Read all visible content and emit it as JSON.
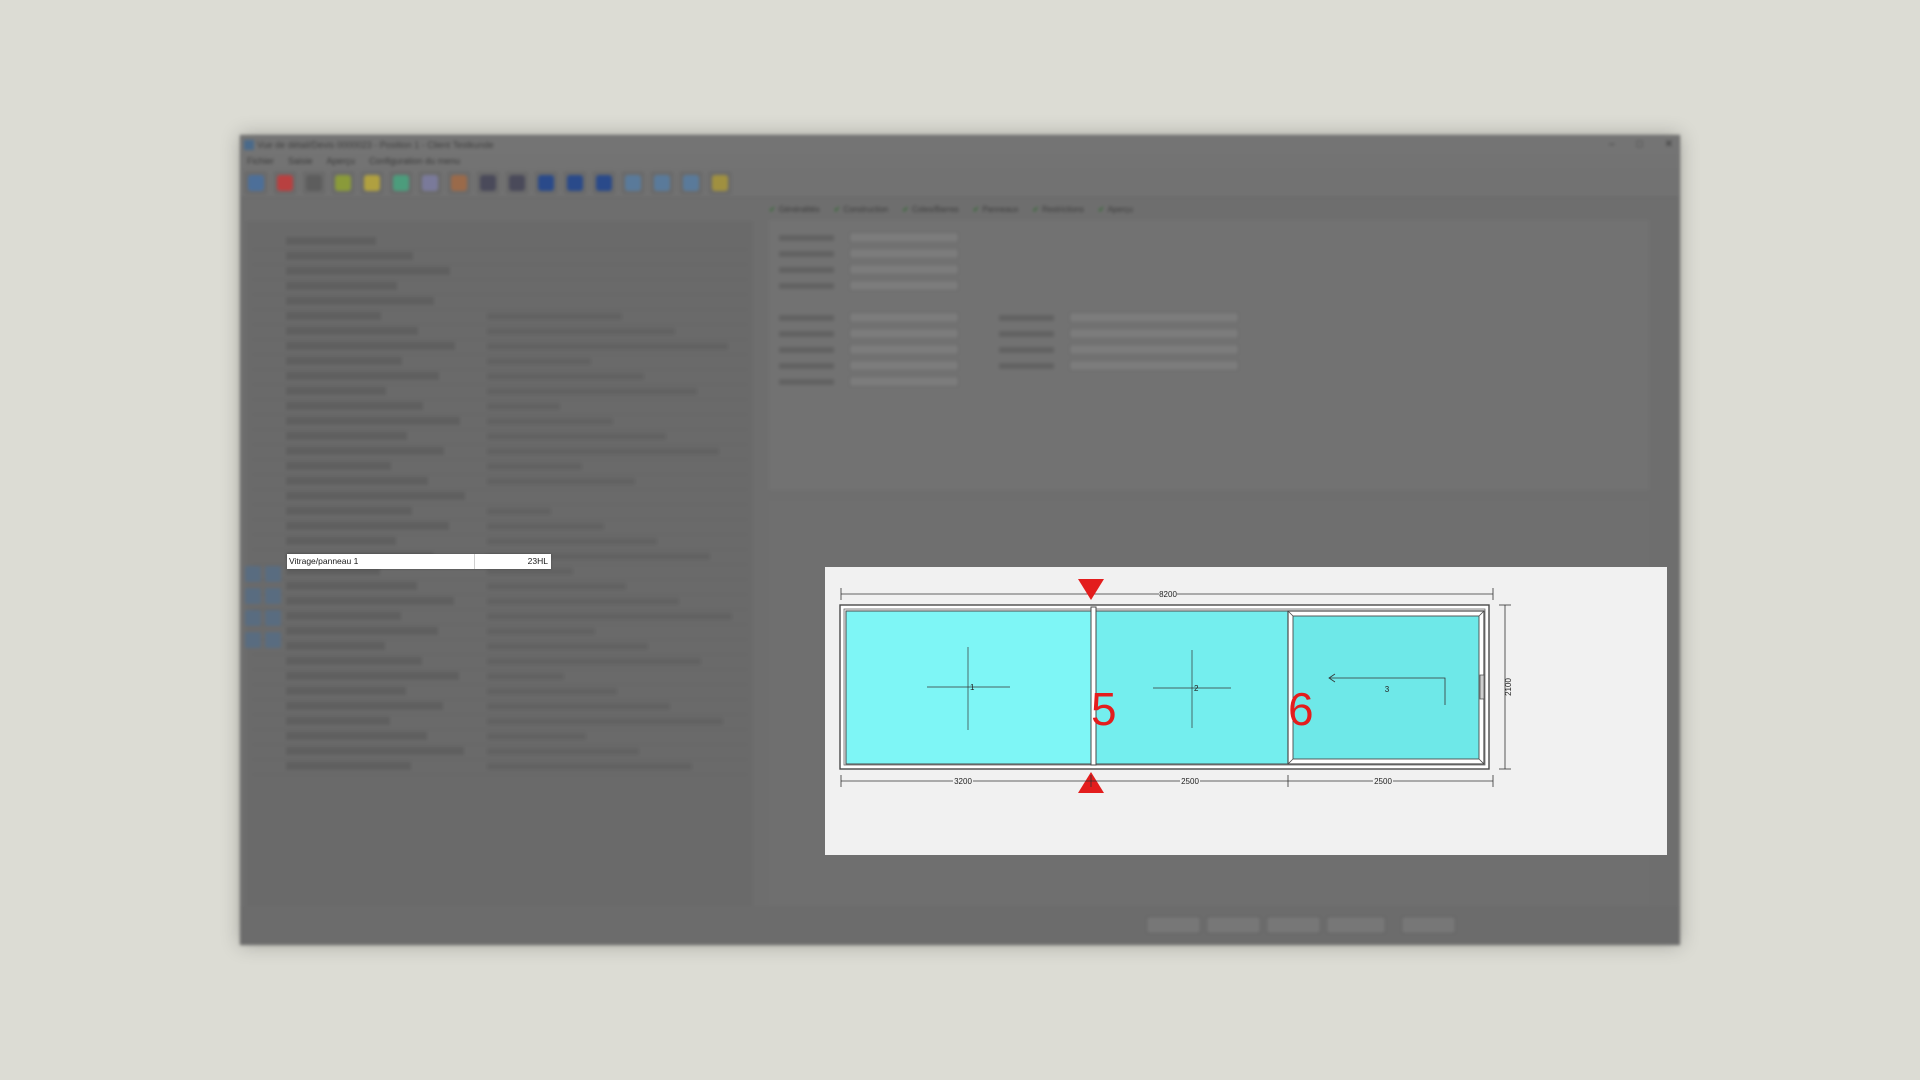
{
  "window": {
    "title": "Vue de détail/Devis 0000023 - Position 1 - Client Testkunde",
    "controls": [
      "–",
      "□",
      "✕"
    ]
  },
  "menu": [
    "Fichier",
    "Saisie",
    "Aperçu",
    "Configuration du menu"
  ],
  "toolbar": {
    "icon_colors": [
      "#4d6f99",
      "#b84040",
      "#5d5d5d",
      "#8a9a3a",
      "#b0a040",
      "#4c9c7c",
      "#7a7a9a",
      "#9a6a4a",
      "#4a4a5a",
      "#4a4a5a",
      "#2a4a8a",
      "#2a4a8a",
      "#2a4a8a",
      "#5a7a9a",
      "#5a7a9a",
      "#5a7a9a",
      "#a09040"
    ]
  },
  "tabs": [
    "Généralités",
    "Construction",
    "Cotes/Barres",
    "Panneaux",
    "Restrictions",
    "Aperçu"
  ],
  "left_panel": {
    "highlighted_row": {
      "label": "Vitrage/panneau 1",
      "value": "23HL"
    }
  },
  "drawing": {
    "total_width": "8200",
    "height": "2100",
    "sections": [
      "3200",
      "2500",
      "2500"
    ],
    "panel_numbers": [
      "1",
      "2",
      "3"
    ],
    "markers": [
      "5",
      "6"
    ],
    "colors": {
      "glass": "#7cf2f2",
      "marker": "#e31d1d",
      "frame": "#4a4a4a"
    }
  },
  "bottom_buttons": [
    "Tous enfermés",
    "<< retour",
    "Choisir",
    "Suivant >>",
    "Fin"
  ]
}
